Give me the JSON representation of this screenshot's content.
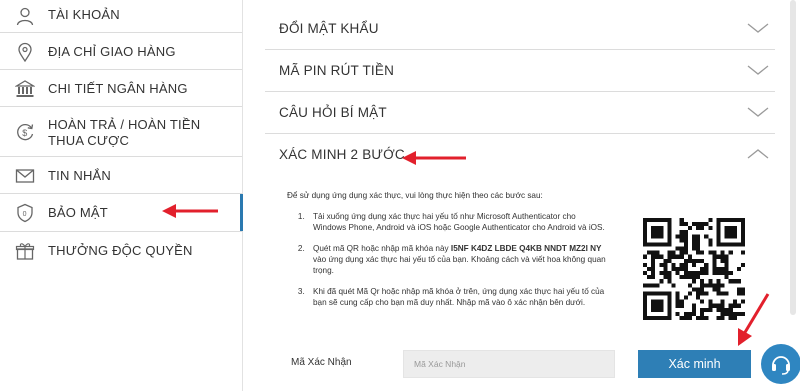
{
  "sidebar": {
    "items": [
      {
        "label": "TÀI KHOẢN",
        "icon": "user-icon"
      },
      {
        "label": "ĐỊA CHỈ GIAO HÀNG",
        "icon": "location-pin-icon"
      },
      {
        "label": "CHI TIẾT NGÂN HÀNG",
        "icon": "bank-icon"
      },
      {
        "label": "HOÀN TRẢ / HOÀN TIỀN THUA CƯỢC",
        "icon": "refund-icon"
      },
      {
        "label": "TIN NHẮN",
        "icon": "envelope-icon"
      },
      {
        "label": "BẢO MẬT",
        "icon": "shield-icon",
        "active": true
      },
      {
        "label": "THƯỞNG ĐỘC QUYỀN",
        "icon": "gift-icon"
      }
    ]
  },
  "main": {
    "sections": [
      {
        "label": "ĐỔI MẬT KHẨU",
        "expanded": false
      },
      {
        "label": "MÃ PIN RÚT TIỀN",
        "expanded": false
      },
      {
        "label": "CÂU HỎI BÍ MẬT",
        "expanded": false
      },
      {
        "label": "XÁC MINH 2 BƯỚC",
        "expanded": true
      }
    ],
    "two_step": {
      "intro": "Để sử dụng ứng dụng xác thực, vui lòng thực hiện theo các bước sau:",
      "steps": [
        {
          "text": "Tải xuống ứng dụng xác thực hai yếu tố như Microsoft Authenticator cho Windows Phone, Android và iOS hoặc Google Authenticator cho Android và iOS."
        },
        {
          "before": "Quét mã QR hoặc nhập mã khóa này",
          "key": "I5NF K4DZ LBDE Q4KB NNDT MZ2I NY",
          "after": "vào ứng dụng xác thực hai yếu tố của bạn. Khoảng cách và viết hoa không quan trọng."
        },
        {
          "text": "Khi đã quét Mã Qr hoặc nhập mã khóa ở trên, ứng dụng xác thực hai yếu tố của bạn sẽ cung cấp cho bạn mã duy nhất. Nhập mã vào ô xác nhận bên dưới."
        }
      ],
      "code_label": "Mã Xác Nhận",
      "code_placeholder": "Mã Xác Nhận",
      "code_value": "",
      "verify_label": "Xác minh"
    }
  },
  "colors": {
    "accent": "#2e7fb6",
    "arrow": "#e2202c",
    "divider": "#dcdcdc",
    "input_bg": "#ededed"
  },
  "support_icon": "headset-icon"
}
